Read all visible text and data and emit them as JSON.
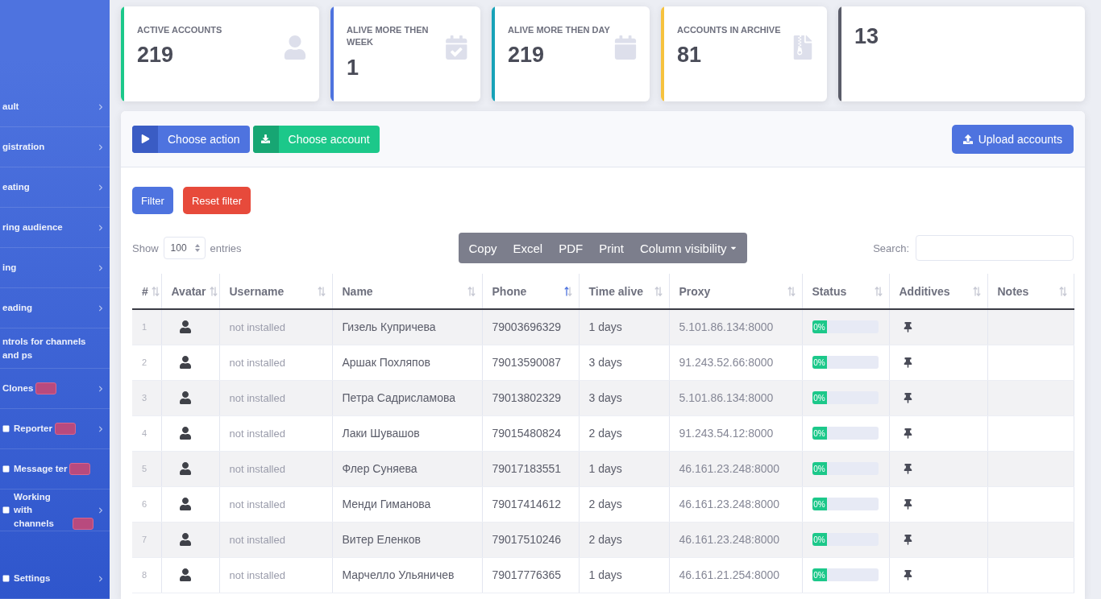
{
  "sidebar": {
    "items": [
      {
        "label": "ault",
        "icon": false,
        "badge": false,
        "chevron": true
      },
      {
        "label": "gistration",
        "icon": false,
        "badge": false,
        "chevron": true
      },
      {
        "label": "eating",
        "icon": false,
        "badge": false,
        "chevron": true
      },
      {
        "label": "ring audience",
        "icon": false,
        "badge": false,
        "chevron": true
      },
      {
        "label": "ing",
        "icon": false,
        "badge": false,
        "chevron": true
      },
      {
        "label": "eading",
        "icon": false,
        "badge": false,
        "chevron": true
      },
      {
        "label": "ntrols for channels and ps",
        "icon": false,
        "badge": false,
        "chevron": false
      },
      {
        "label": "Clones",
        "icon": false,
        "badge": true,
        "chevron": true
      },
      {
        "label": "Reporter",
        "icon": true,
        "badge": true,
        "chevron": true
      },
      {
        "label": "Message ter",
        "icon": true,
        "badge": true,
        "chevron": false
      },
      {
        "label": "Working with channels",
        "icon": true,
        "badge": true,
        "chevron": true
      },
      {
        "label": "Settings",
        "icon": true,
        "badge": false,
        "chevron": true
      }
    ]
  },
  "stats": [
    {
      "title": "ACTIVE ACCOUNTS",
      "value": "219",
      "color": "#1cc88a"
    },
    {
      "title": "ALIVE MORE THEN WEEK",
      "value": "1",
      "color": "#4e73df"
    },
    {
      "title": "ALIVE MORE THEN DAY",
      "value": "219",
      "color": "#17a2b8"
    },
    {
      "title": "ACCOUNTS IN ARCHIVE",
      "value": "81",
      "color": "#f6c23e"
    },
    {
      "value": "13",
      "color": "#5a5c69"
    }
  ],
  "actions": {
    "buttons": [
      {
        "label": "Choose action",
        "kind": "primary"
      },
      {
        "label": "Choose account",
        "kind": "success"
      }
    ],
    "upload": {
      "label": "Upload accounts"
    }
  },
  "filters": [
    {
      "label": "Filter",
      "kind": "primary"
    },
    {
      "label": "Reset filter",
      "kind": "danger"
    }
  ],
  "length": {
    "prefix": "Show",
    "value": "100",
    "suffix": "entries"
  },
  "export_buttons": [
    {
      "label": "Copy",
      "dropdown": false
    },
    {
      "label": "Excel",
      "dropdown": false
    },
    {
      "label": "PDF",
      "dropdown": false
    },
    {
      "label": "Print",
      "dropdown": false
    },
    {
      "label": "Column visibility",
      "dropdown": true
    }
  ],
  "search": {
    "label": "Search:"
  },
  "table": {
    "columns": [
      {
        "label": "#",
        "sorted": false
      },
      {
        "label": "Avatar",
        "sorted": false
      },
      {
        "label": "Username",
        "sorted": false
      },
      {
        "label": "Name",
        "sorted": false
      },
      {
        "label": "Phone",
        "sorted": true
      },
      {
        "label": "Time alive",
        "sorted": false
      },
      {
        "label": "Proxy",
        "sorted": false
      },
      {
        "label": "Status",
        "sorted": false
      },
      {
        "label": "Additives",
        "sorted": false
      },
      {
        "label": "Notes",
        "sorted": false
      }
    ],
    "rows": [
      {
        "number": "1",
        "username": "not installed",
        "name": "Гизель Купричева",
        "phone": "79003696329",
        "time_alive": "1 days",
        "proxy": "5.101.86.134:8000",
        "status": {
          "label": "0%",
          "level": 0
        }
      },
      {
        "number": "2",
        "username": "not installed",
        "name": "Аршак Похляпов",
        "phone": "79013590087",
        "time_alive": "3 days",
        "proxy": "91.243.52.66:8000",
        "status": {
          "label": "0%",
          "level": 0
        }
      },
      {
        "number": "3",
        "username": "not installed",
        "name": "Петра Садрисламова",
        "phone": "79013802329",
        "time_alive": "3 days",
        "proxy": "5.101.86.134:8000",
        "status": {
          "label": "0%",
          "level": 0
        }
      },
      {
        "number": "4",
        "username": "not installed",
        "name": "Лаки Шувашов",
        "phone": "79015480824",
        "time_alive": "2 days",
        "proxy": "91.243.54.12:8000",
        "status": {
          "label": "0%",
          "level": 0
        }
      },
      {
        "number": "5",
        "username": "not installed",
        "name": "Флер Суняева",
        "phone": "79017183551",
        "time_alive": "1 days",
        "proxy": "46.161.23.248:8000",
        "status": {
          "label": "0%",
          "level": 0
        }
      },
      {
        "number": "6",
        "username": "not installed",
        "name": "Менди Гиманова",
        "phone": "79017414612",
        "time_alive": "2 days",
        "proxy": "46.161.23.248:8000",
        "status": {
          "label": "0%",
          "level": 0
        }
      },
      {
        "number": "7",
        "username": "not installed",
        "name": "Витер Еленков",
        "phone": "79017510246",
        "time_alive": "2 days",
        "proxy": "46.161.23.248:8000",
        "status": {
          "label": "0%",
          "level": 0
        }
      },
      {
        "number": "8",
        "username": "not installed",
        "name": "Марчелло Ульяничев",
        "phone": "79017776365",
        "time_alive": "1 days",
        "proxy": "46.161.21.254:8000",
        "status": {
          "label": "0%",
          "level": 0
        }
      }
    ]
  }
}
